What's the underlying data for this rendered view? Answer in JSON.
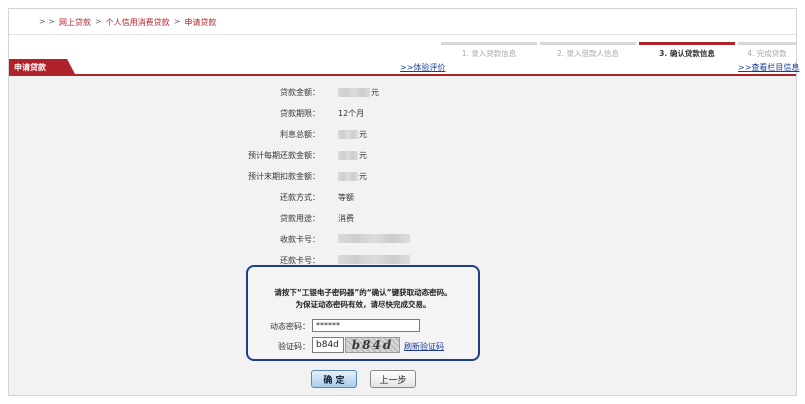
{
  "breadcrumb": {
    "prefix": "> >",
    "items": [
      "网上贷款",
      "个人信用消费贷款",
      "申请贷款"
    ],
    "separator": ">"
  },
  "steps": [
    {
      "label": "1. 录入贷款信息",
      "active": false
    },
    {
      "label": "2. 录入借款人信息",
      "active": false
    },
    {
      "label": "3. 确认贷款信息",
      "active": true
    },
    {
      "label": "4. 完成贷款",
      "active": false
    }
  ],
  "section": {
    "title": "申请贷款",
    "feedback_arrow": ">>",
    "feedback_link": "体验评价",
    "column_arrow": ">>",
    "column_link": "查看栏目信息"
  },
  "info": {
    "loan_amount": {
      "label": "贷款金额：",
      "suffix": "元"
    },
    "loan_term": {
      "label": "贷款期限：",
      "value": "12个月"
    },
    "total_interest": {
      "label": "利息总额：",
      "suffix": "元"
    },
    "monthly_repay": {
      "label": "预计每期还款金额：",
      "suffix": "元"
    },
    "last_repay": {
      "label": "预计末期扣款金额：",
      "suffix": "元"
    },
    "repay_method": {
      "label": "还款方式：",
      "value": "等额"
    },
    "loan_purpose": {
      "label": "贷款用途：",
      "value": "消费"
    },
    "receive_card": {
      "label": "收款卡号："
    },
    "repay_card": {
      "label": "还款卡号："
    }
  },
  "otp": {
    "instruction_line1": "请按下“工银电子密码器”的“确认”键获取动态密码。",
    "instruction_line2": "为保证动态密码有效，请尽快完成交易。",
    "password_label": "动态密码：",
    "password_value": "******",
    "captcha_label": "验证码：",
    "captcha_value": "b84d",
    "captcha_image_text": "b84d",
    "refresh_link": "刷新验证码"
  },
  "buttons": {
    "confirm": "确 定",
    "back": "上一步"
  },
  "colors": {
    "brand_red": "#b0222a",
    "link_blue": "#1a3c9c",
    "otp_border": "#1c3f86"
  }
}
